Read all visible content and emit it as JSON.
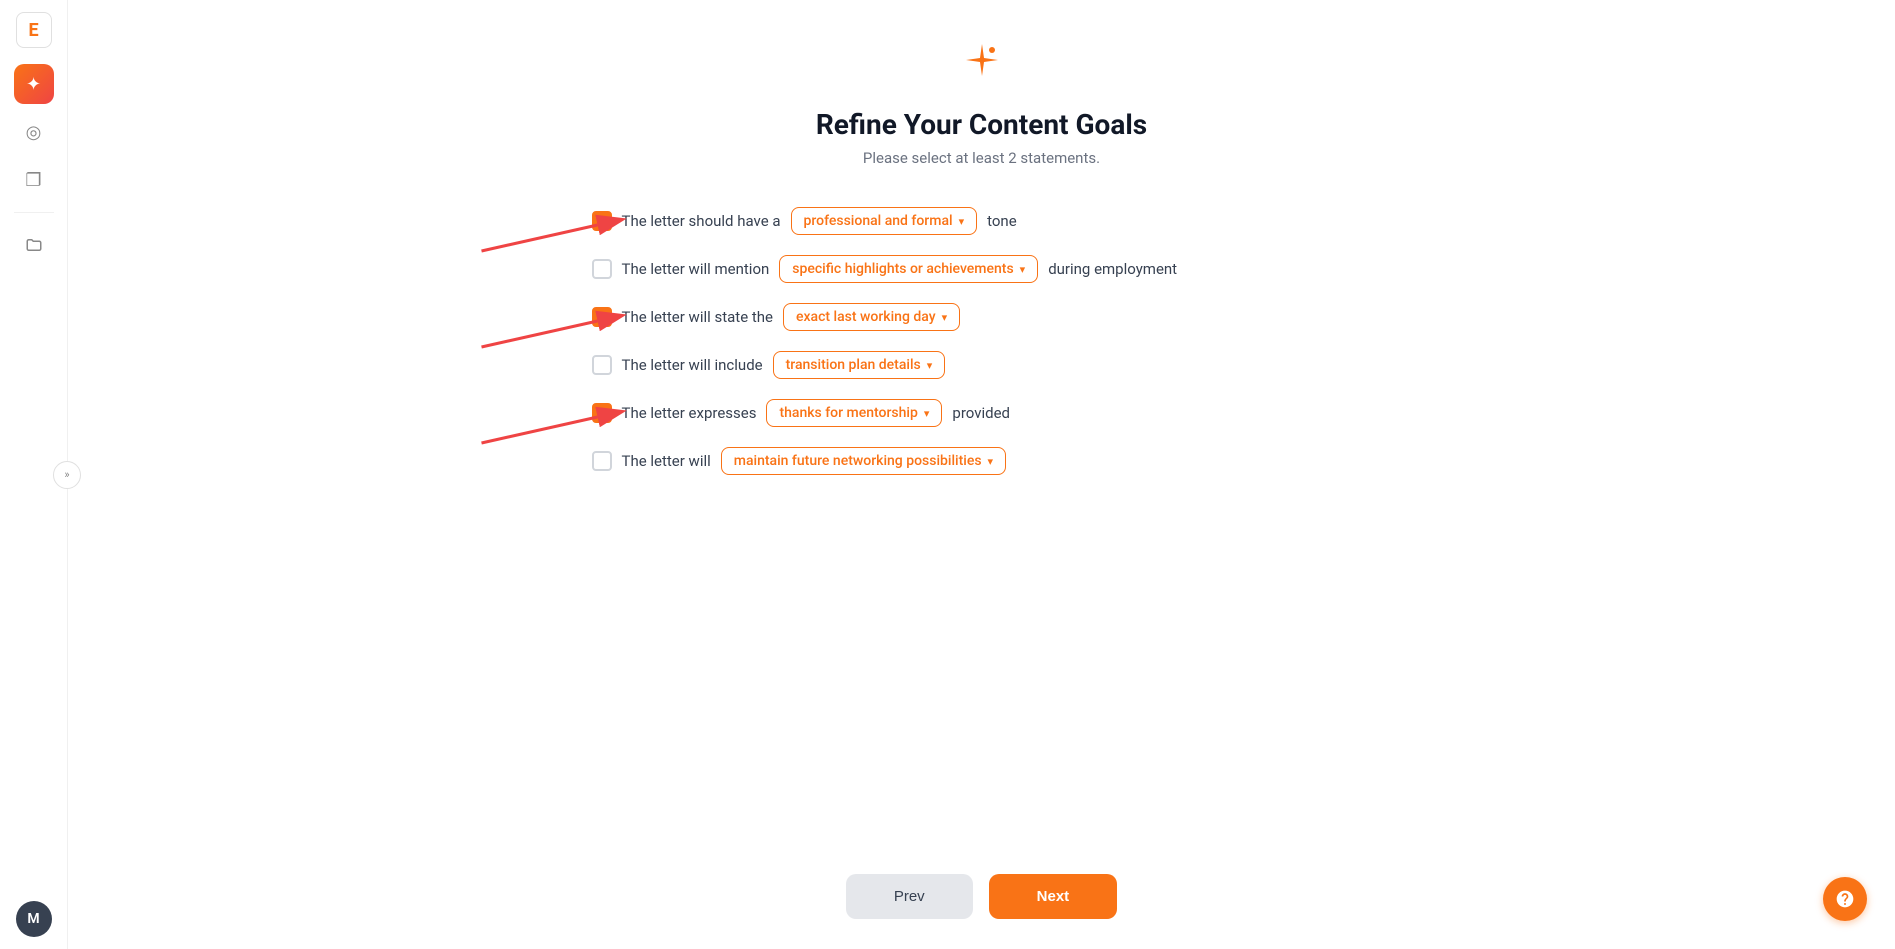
{
  "sidebar": {
    "logo_icon": "E",
    "toggle_icon": "»",
    "avatar_label": "M",
    "items": [
      {
        "name": "sparkle",
        "icon": "✦",
        "active": true
      },
      {
        "name": "target",
        "icon": "◎",
        "active": false
      },
      {
        "name": "copy",
        "icon": "❐",
        "active": false
      },
      {
        "name": "folder",
        "icon": "🗂",
        "active": false
      }
    ]
  },
  "page": {
    "icon": "✦",
    "title": "Refine Your Content Goals",
    "subtitle": "Please select at least 2 statements."
  },
  "goals": [
    {
      "id": "tone",
      "checked": true,
      "prefix": "The letter should have a",
      "dropdown_value": "professional and formal",
      "suffix": "tone"
    },
    {
      "id": "highlights",
      "checked": false,
      "prefix": "The letter will mention",
      "dropdown_value": "specific highlights or achievements",
      "suffix": "during employment"
    },
    {
      "id": "lastday",
      "checked": true,
      "prefix": "The letter will state the",
      "dropdown_value": "exact last working day",
      "suffix": ""
    },
    {
      "id": "transition",
      "checked": false,
      "prefix": "The letter will include",
      "dropdown_value": "transition plan details",
      "suffix": ""
    },
    {
      "id": "mentorship",
      "checked": true,
      "prefix": "The letter expresses",
      "dropdown_value": "thanks for mentorship",
      "suffix": "provided"
    },
    {
      "id": "networking",
      "checked": false,
      "prefix": "The letter will",
      "dropdown_value": "maintain future networking possibilities",
      "suffix": ""
    }
  ],
  "buttons": {
    "prev_label": "Prev",
    "next_label": "Next"
  },
  "help_icon": "?",
  "colors": {
    "orange": "#f97316",
    "checked_bg": "#f97316",
    "unchecked_border": "#d1d5db"
  }
}
